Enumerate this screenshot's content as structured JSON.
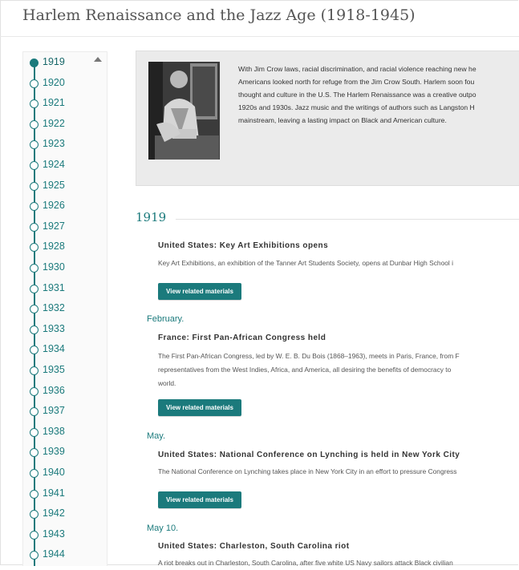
{
  "page": {
    "title": "Harlem Renaissance and the Jazz Age (1918-1945)"
  },
  "colors": {
    "accent": "#1b7a7c",
    "intro_bg": "#ebebeb"
  },
  "sidebar": {
    "years": [
      "1919",
      "1920",
      "1921",
      "1922",
      "1923",
      "1924",
      "1925",
      "1926",
      "1927",
      "1928",
      "1930",
      "1931",
      "1932",
      "1933",
      "1934",
      "1935",
      "1936",
      "1937",
      "1938",
      "1939",
      "1940",
      "1941",
      "1942",
      "1943",
      "1944"
    ],
    "active_year": "1919",
    "scroll_icon": "caret-up-icon"
  },
  "intro": {
    "lines": [
      "With Jim Crow laws, racial discrimination, and racial violence reaching new he",
      "Americans looked north for refuge from the Jim Crow South. Harlem soon fou",
      "thought and culture in the U.S. The Harlem Renaissance was a creative outpo",
      "1920s and 1930s. Jazz music and the writings of authors such as Langston H",
      "mainstream, leaving a lasting impact on Black and American culture."
    ]
  },
  "timeline": {
    "year": "1919",
    "button_label": "View related materials",
    "events": [
      {
        "date": "",
        "title": "United States: Key Art Exhibitions opens",
        "lines": [
          "Key Art Exhibitions, an exhibition of the Tanner Art Students Society, opens at Dunbar High School i"
        ]
      },
      {
        "date": "February.",
        "title": "France: First Pan-African Congress held",
        "lines": [
          "The First Pan-African Congress, led by W. E. B. Du Bois (1868–1963), meets in Paris, France, from F",
          "representatives from the West Indies, Africa, and America, all desiring the benefits of democracy to",
          "world."
        ]
      },
      {
        "date": "May.",
        "title": "United States: National Conference on Lynching is held in New York City",
        "lines": [
          "The National Conference on Lynching takes place in New York City in an effort to pressure Congress"
        ]
      },
      {
        "date": "May 10.",
        "title": "United States: Charleston, South Carolina riot",
        "lines": [
          "A riot breaks out in Charleston, South Carolina, after five white US Navy sailors attack Black civilian"
        ]
      }
    ]
  }
}
